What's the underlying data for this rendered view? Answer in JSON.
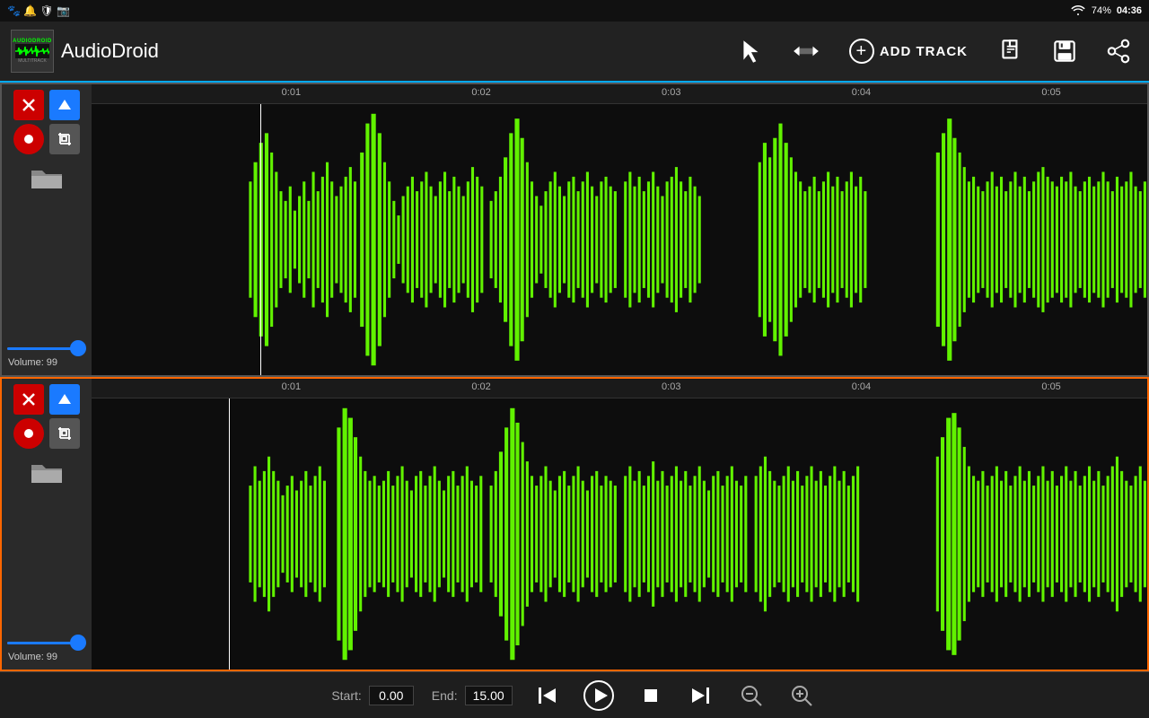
{
  "statusBar": {
    "leftIcons": [
      "🐾",
      "🔔",
      "🛡",
      "📷"
    ],
    "battery": "74%",
    "time": "04:36",
    "wifiIcon": "wifi"
  },
  "toolbar": {
    "appName": "AudioDroid",
    "logoText": "AUDIODROID",
    "cursorToolLabel": "cursor",
    "swapToolLabel": "swap",
    "addTrackLabel": "ADD TRACK",
    "newFileLabel": "new",
    "saveLabel": "save",
    "shareLabel": "share"
  },
  "tracks": [
    {
      "id": "track1",
      "active": false,
      "volumeLabel": "Volume: 99",
      "volumeValue": 99,
      "timeMarkers": [
        "0:01",
        "0:02",
        "0:03",
        "0:04",
        "0:05"
      ]
    },
    {
      "id": "track2",
      "active": true,
      "volumeLabel": "Volume: 99",
      "volumeValue": 99,
      "timeMarkers": [
        "0:01",
        "0:02",
        "0:03",
        "0:04",
        "0:05"
      ]
    }
  ],
  "transport": {
    "startLabel": "Start:",
    "startValue": "0.00",
    "endLabel": "End:",
    "endValue": "15.00",
    "zoomInLabel": "zoom-in",
    "zoomOutLabel": "zoom-out"
  }
}
